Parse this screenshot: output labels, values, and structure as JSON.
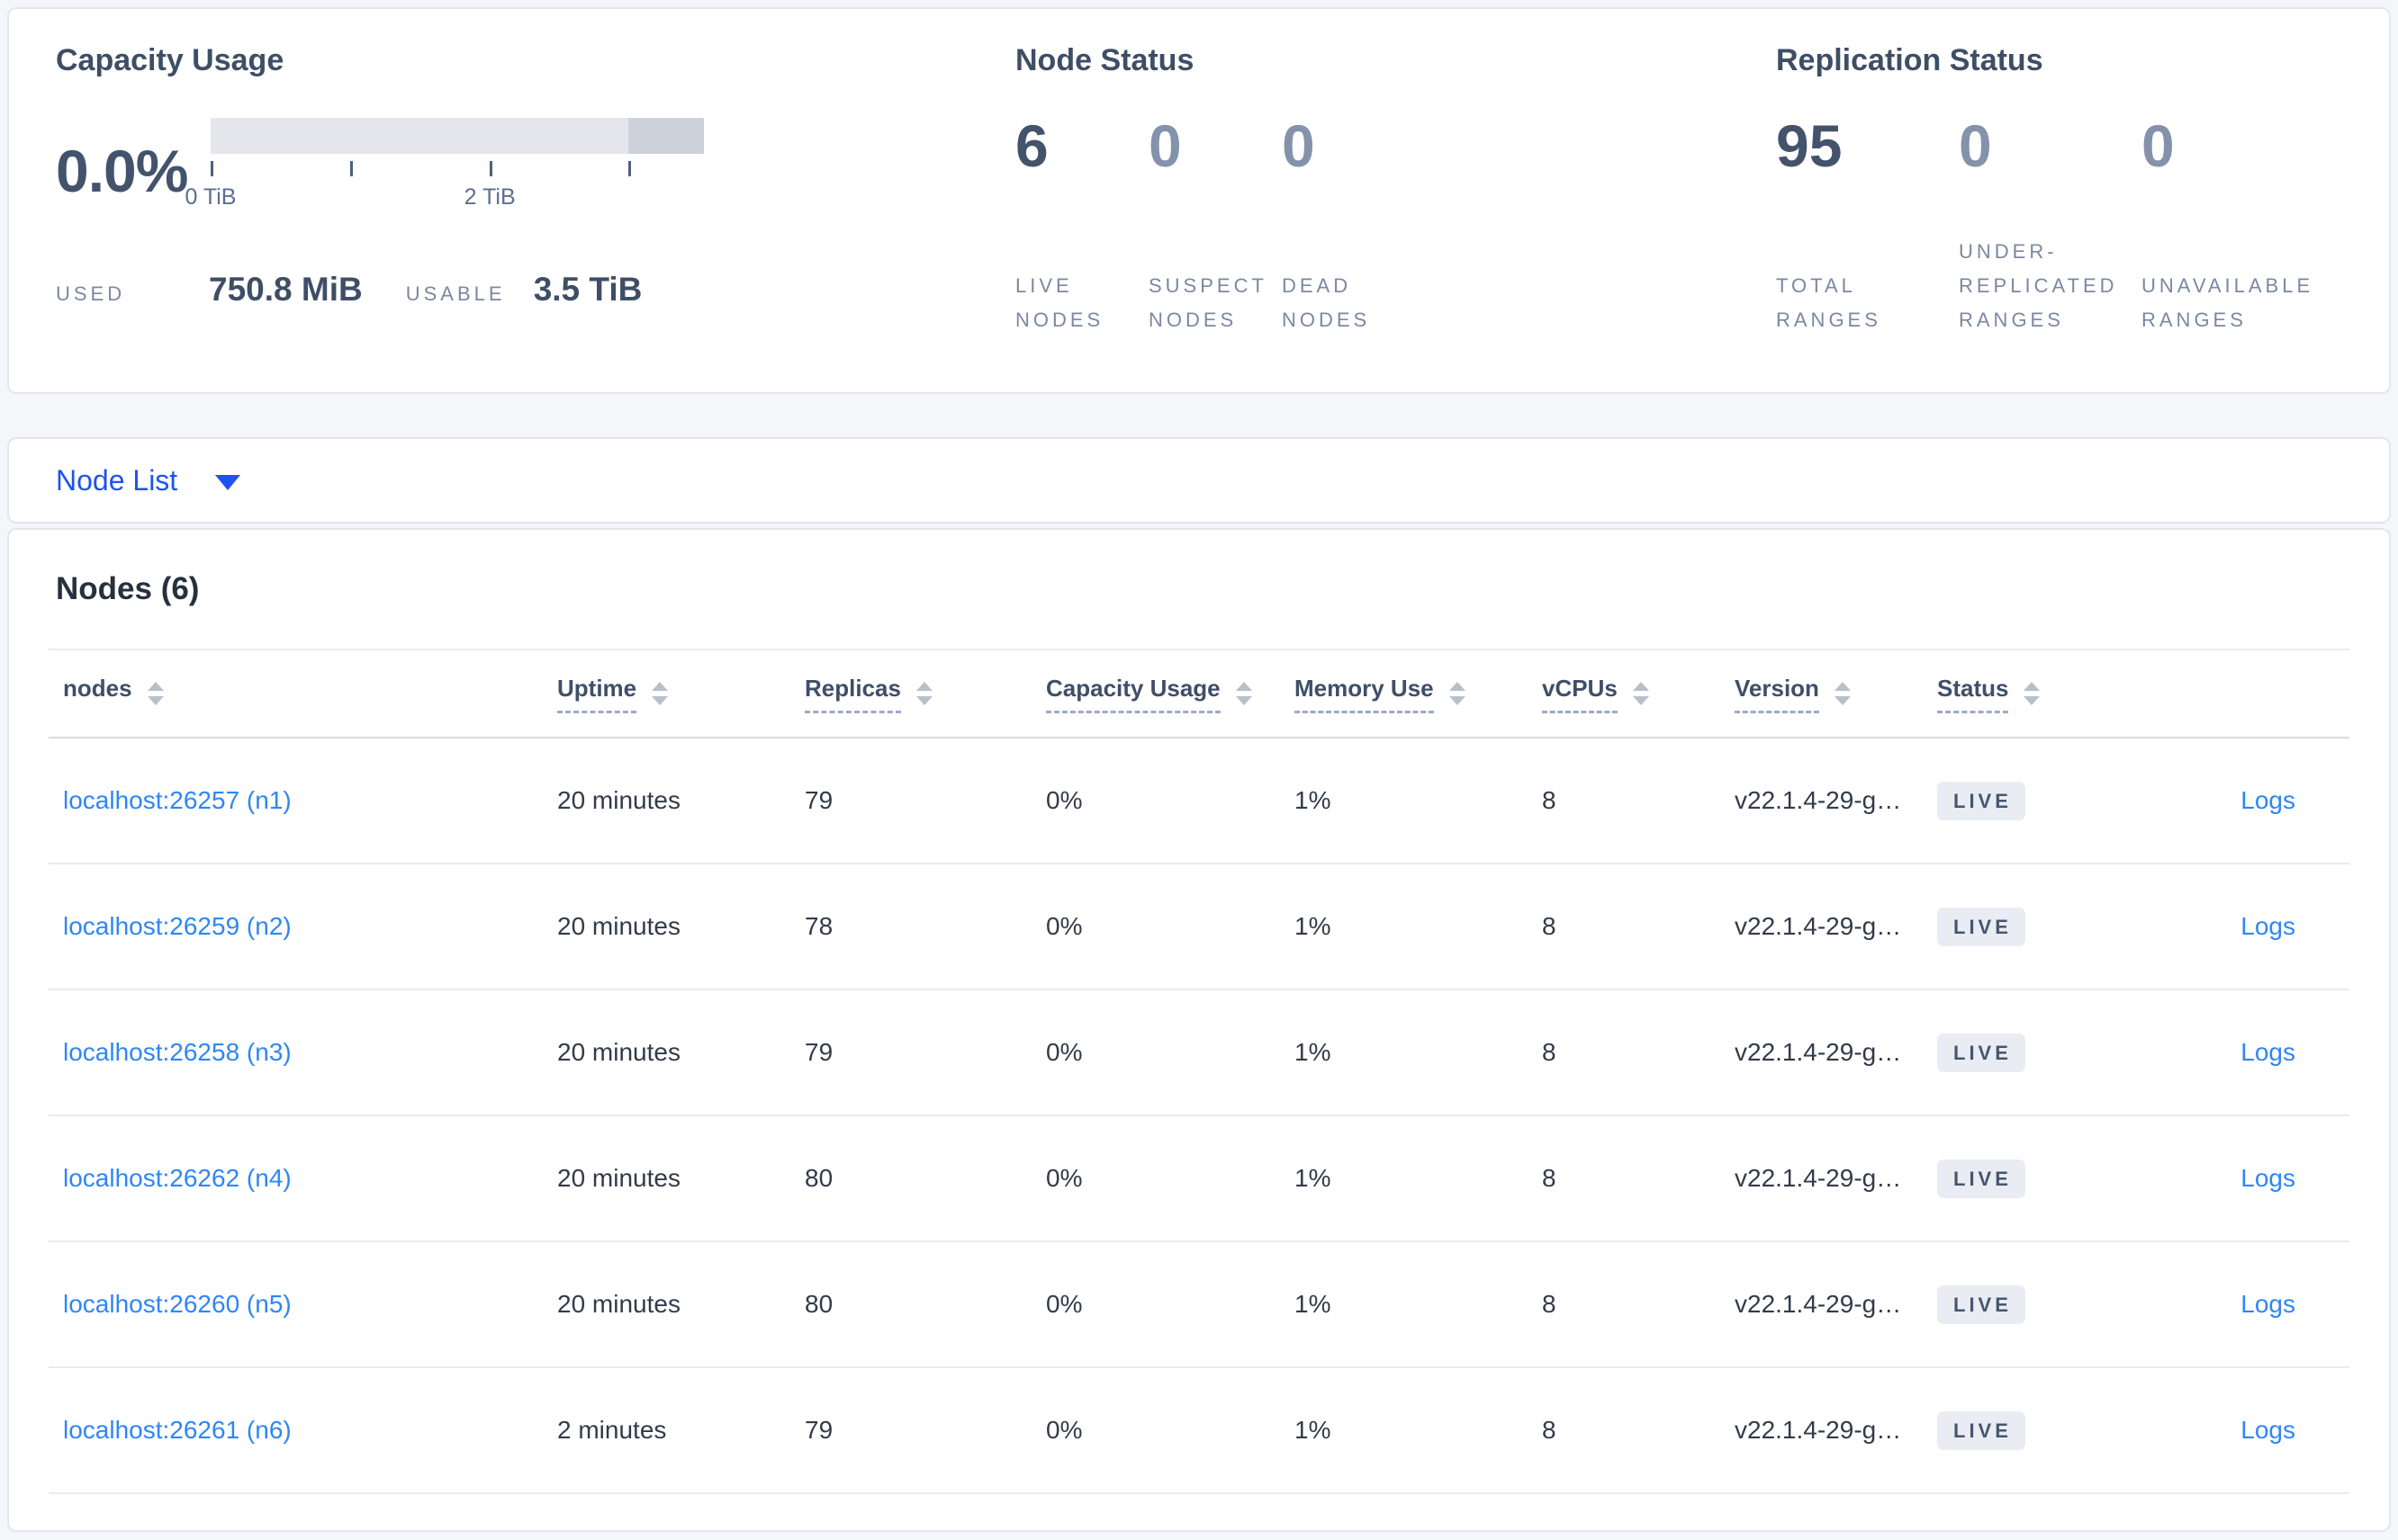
{
  "colors": {
    "page_background": "#f5f6fa",
    "selector_blue": "#1d53ee",
    "link_blue": "#2f86f5",
    "stat_emphasis": "#44536c",
    "stat_muted": "#8492ac",
    "bar_light": "#e5e6ec",
    "bar_dark": "#cdd1db",
    "badge_background": "#e9edf3"
  },
  "summary": {
    "capacity": {
      "title": "Capacity Usage",
      "percent": "0.0%",
      "tick_labels": [
        "0 TiB",
        "2 TiB"
      ],
      "used_label": "USED",
      "used_value": "750.8 MiB",
      "usable_label": "USABLE",
      "usable_value": "3.5 TiB"
    },
    "node_status": {
      "title": "Node Status",
      "stats": [
        {
          "value": "6",
          "label": "LIVE NODES"
        },
        {
          "value": "0",
          "label": "SUSPECT NODES"
        },
        {
          "value": "0",
          "label": "DEAD NODES"
        }
      ]
    },
    "replication": {
      "title": "Replication Status",
      "stats": [
        {
          "value": "95",
          "label": "TOTAL RANGES"
        },
        {
          "value": "0",
          "label": "UNDER-REPLICATED RANGES"
        },
        {
          "value": "0",
          "label": "UNAVAILABLE RANGES"
        }
      ]
    }
  },
  "view_selector": {
    "label": "Node List"
  },
  "table": {
    "title": "Nodes (6)",
    "columns": [
      "nodes",
      "Uptime",
      "Replicas",
      "Capacity Usage",
      "Memory Use",
      "vCPUs",
      "Version",
      "Status"
    ],
    "rows": [
      {
        "node": "localhost:26257 (n1)",
        "uptime": "20 minutes",
        "replicas": "79",
        "capacity": "0%",
        "memory": "1%",
        "vcpus": "8",
        "version": "v22.1.4-29-g…",
        "status": "LIVE",
        "logs": "Logs"
      },
      {
        "node": "localhost:26259 (n2)",
        "uptime": "20 minutes",
        "replicas": "78",
        "capacity": "0%",
        "memory": "1%",
        "vcpus": "8",
        "version": "v22.1.4-29-g…",
        "status": "LIVE",
        "logs": "Logs"
      },
      {
        "node": "localhost:26258 (n3)",
        "uptime": "20 minutes",
        "replicas": "79",
        "capacity": "0%",
        "memory": "1%",
        "vcpus": "8",
        "version": "v22.1.4-29-g…",
        "status": "LIVE",
        "logs": "Logs"
      },
      {
        "node": "localhost:26262 (n4)",
        "uptime": "20 minutes",
        "replicas": "80",
        "capacity": "0%",
        "memory": "1%",
        "vcpus": "8",
        "version": "v22.1.4-29-g…",
        "status": "LIVE",
        "logs": "Logs"
      },
      {
        "node": "localhost:26260 (n5)",
        "uptime": "20 minutes",
        "replicas": "80",
        "capacity": "0%",
        "memory": "1%",
        "vcpus": "8",
        "version": "v22.1.4-29-g…",
        "status": "LIVE",
        "logs": "Logs"
      },
      {
        "node": "localhost:26261 (n6)",
        "uptime": "2 minutes",
        "replicas": "79",
        "capacity": "0%",
        "memory": "1%",
        "vcpus": "8",
        "version": "v22.1.4-29-g…",
        "status": "LIVE",
        "logs": "Logs"
      }
    ]
  }
}
